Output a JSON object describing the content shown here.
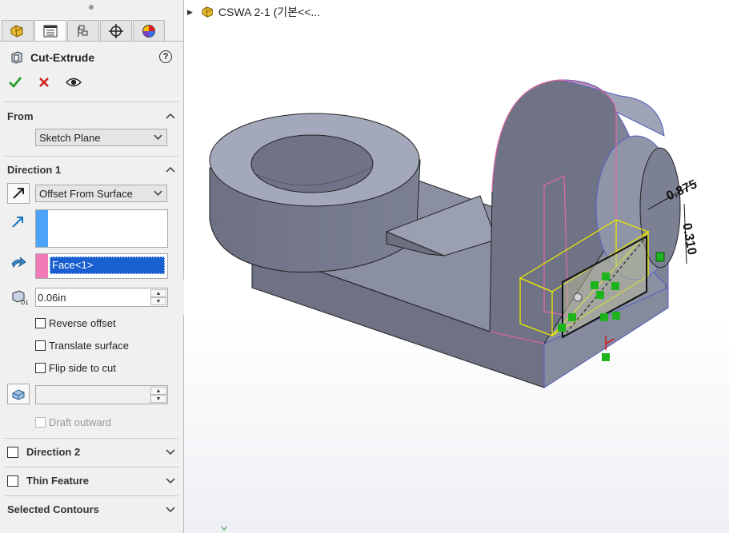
{
  "panel": {
    "tabs": [
      {
        "name": "feature-manager",
        "active": false
      },
      {
        "name": "property-manager",
        "active": true
      },
      {
        "name": "configuration-manager",
        "active": false
      },
      {
        "name": "dim-xpert-manager",
        "active": false
      },
      {
        "name": "display-manager",
        "active": false
      }
    ],
    "title": "Cut-Extrude",
    "help_label": "?",
    "from": {
      "label": "From",
      "value": "Sketch Plane"
    },
    "direction1": {
      "label": "Direction 1",
      "end_condition": "Offset From Surface",
      "face_value": "Face<1>",
      "offset_value": "0.06in",
      "reverse_offset": "Reverse offset",
      "translate_surface": "Translate surface",
      "flip_side": "Flip side to cut",
      "draft_outward": "Draft outward"
    },
    "direction2_label": "Direction 2",
    "thin_feature_label": "Thin Feature",
    "selected_contours_label": "Selected Contours"
  },
  "tree": {
    "part_name": "CSWA 2-1  (기본<<..."
  },
  "model": {
    "dim_diameter": "0.875",
    "dim_height": "0.310"
  },
  "colors": {
    "accent_blue": "#4da3f7",
    "accent_pink": "#f07ab8",
    "selection_bg": "#1a5fd0",
    "preview_yellow": "#e8e800"
  }
}
